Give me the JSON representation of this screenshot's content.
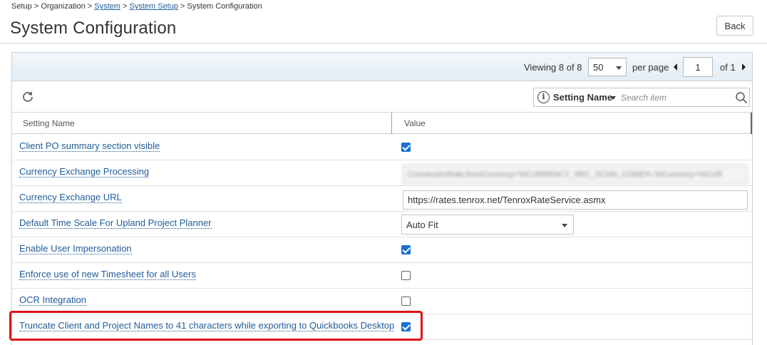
{
  "breadcrumb": {
    "items": [
      {
        "label": "Setup",
        "link": false
      },
      {
        "label": "Organization",
        "link": false
      },
      {
        "label": "System",
        "link": true
      },
      {
        "label": "System Setup",
        "link": true
      },
      {
        "label": "System Configuration",
        "link": false
      }
    ],
    "separator": ">"
  },
  "page_title": "System Configuration",
  "back_label": "Back",
  "pager": {
    "viewing_prefix": "Viewing",
    "viewing_count": "8",
    "of_word": "of",
    "viewing_total": "8",
    "page_size": "50",
    "per_page_label": "per page",
    "current_page": "1",
    "of_total_pages": "of 1"
  },
  "toolbar": {
    "search_field": "Setting Name",
    "search_placeholder": "Search item",
    "info_glyph": "i"
  },
  "columns": {
    "name": "Setting Name",
    "value": "Value"
  },
  "rows": [
    {
      "name": "Client PO summary section visible",
      "type": "checkbox",
      "checked": true
    },
    {
      "name": "Currency Exchange Processing",
      "type": "text-blurred",
      "value": "ConversionRate.fromCurrency=%CURRENCY_SRC_XCHG_CODE%.ToCurrency=%CUR"
    },
    {
      "name": "Currency Exchange URL",
      "type": "text",
      "value": "https://rates.tenrox.net/TenroxRateService.asmx"
    },
    {
      "name": "Default Time Scale For Upland Project Planner",
      "type": "select",
      "value": "Auto Fit"
    },
    {
      "name": "Enable User Impersonation",
      "type": "checkbox",
      "checked": true
    },
    {
      "name": "Enforce use of new Timesheet for all Users",
      "type": "checkbox",
      "checked": false
    },
    {
      "name": "OCR Integration",
      "type": "checkbox",
      "checked": false
    },
    {
      "name": "Truncate Client and Project Names to 41 characters while exporting to Quickbooks Desktop",
      "type": "checkbox",
      "checked": true
    }
  ],
  "colors": {
    "link": "#1f5c99",
    "checkbox_checked": "#1a6fd1",
    "highlight": "#e0101a",
    "pager_bg": "#e3edf5"
  }
}
